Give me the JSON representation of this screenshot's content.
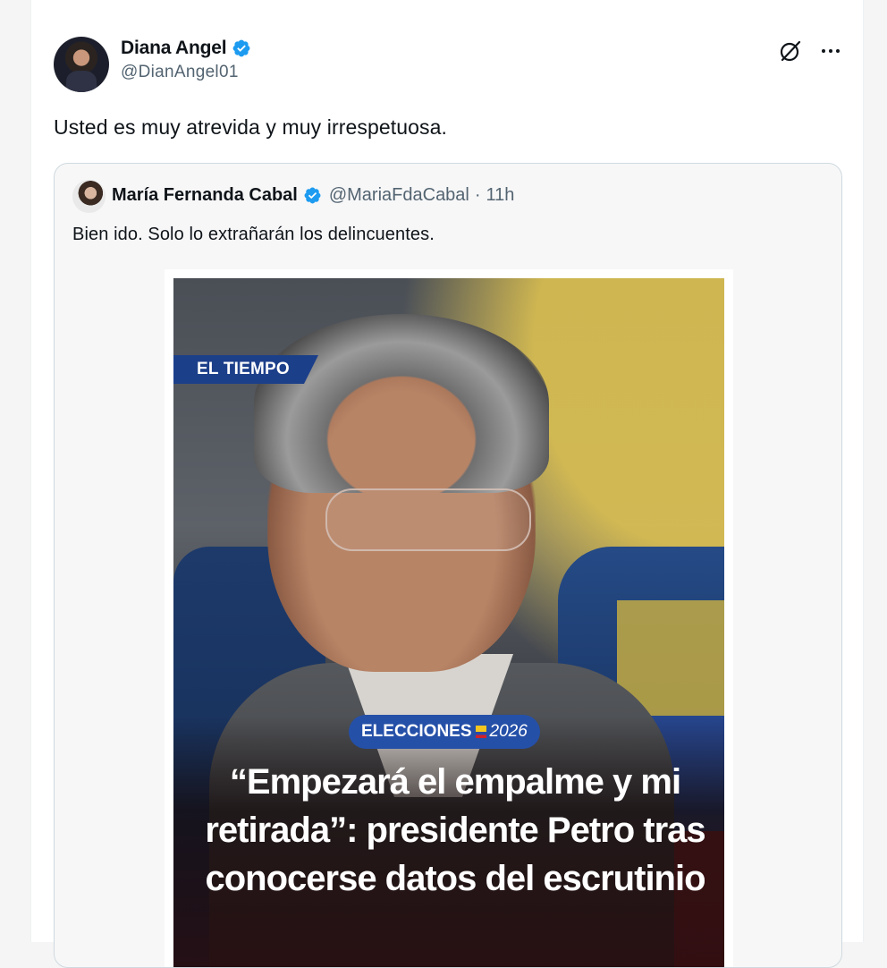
{
  "tweet": {
    "author_name": "Diana Angel",
    "author_handle": "@DianAngel01",
    "text": "Usted es muy atrevida y muy irrespetuosa.",
    "icons": [
      "verified-icon",
      "grok-icon",
      "more-icon"
    ]
  },
  "quoted": {
    "author_name": "María Fernanda Cabal",
    "author_handle": "@MariaFdaCabal",
    "separator": "·",
    "time": "11h",
    "text": "Bien ido. Solo lo extrañarán los delincuentes.",
    "media": {
      "brand": "EL TIEMPO",
      "badge_label": "ELECCIONES",
      "badge_year": "2026",
      "headline": "“Empezará el empalme y mi retirada”: presidente Petro tras conocerse datos del escrutinio"
    }
  },
  "colors": {
    "verified": "#1d9bf0",
    "muted_text": "#536471",
    "brand_blue": "#1c3f8a",
    "badge_blue": "#2550a8"
  }
}
